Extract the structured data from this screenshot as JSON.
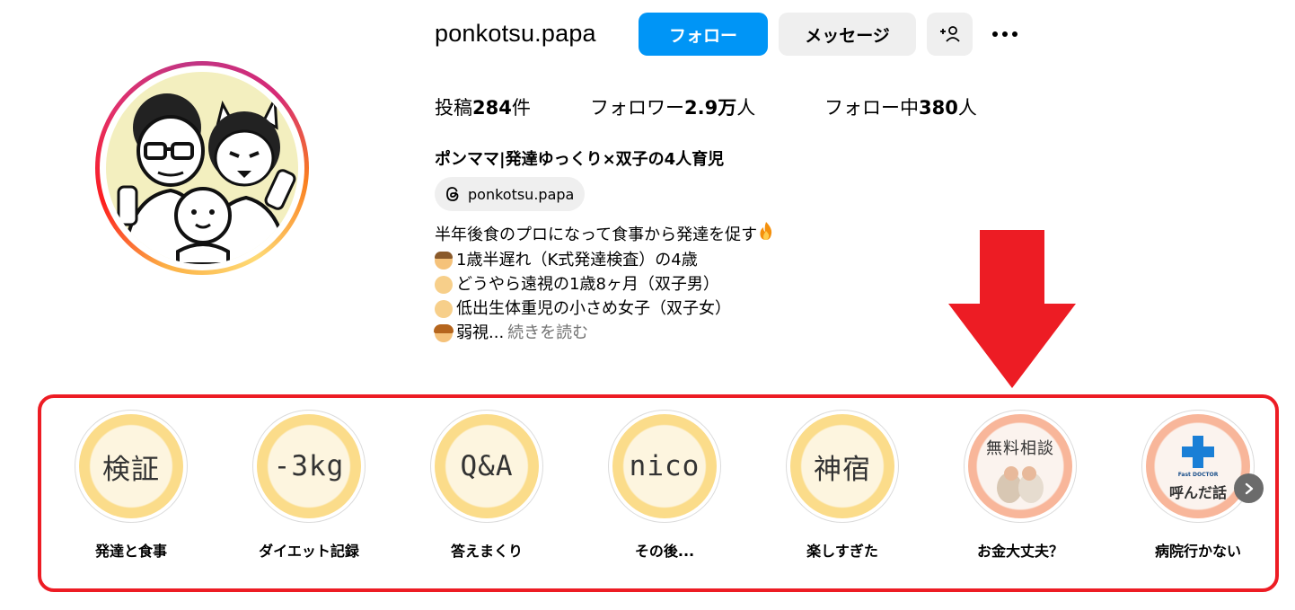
{
  "profile": {
    "username": "ponkotsu.papa",
    "follow_label": "フォロー",
    "message_label": "メッセージ",
    "add_friend_icon": "person-plus-icon",
    "more_icon": "more-options-icon",
    "stats": {
      "posts_prefix": "投稿",
      "posts_value": "284",
      "posts_suffix": "件",
      "followers_prefix": "フォロワー",
      "followers_value": "2.9万",
      "followers_suffix": "人",
      "following_prefix": "フォロー中",
      "following_value": "380",
      "following_suffix": "人"
    },
    "full_name": "ポンママ|発達ゆっくり×双子の4人育児",
    "threads_handle": "ponkotsu.papa",
    "bio_lines": [
      "半年後食のプロになって食事から発達を促す",
      "1歳半遅れ（K式発達検査）の4歳",
      "どうやら遠視の1歳8ヶ月（双子男）",
      "低出生体重児の小さめ女子（双子女）",
      "弱視..."
    ],
    "read_more": "続きを読む"
  },
  "highlights": [
    {
      "cover_text": "検証",
      "label": "発達と食事"
    },
    {
      "cover_text": "-3kg",
      "label": "ダイエット記録"
    },
    {
      "cover_text": "Q&A",
      "label": "答えまくり"
    },
    {
      "cover_text": "nico",
      "label": "その後..."
    },
    {
      "cover_text": "神宿",
      "label": "楽しすぎた"
    },
    {
      "cover_text": "無料相談",
      "label": "お金大丈夫？"
    },
    {
      "cover_text": "呼んだ話",
      "cover_logo": "Fast DOCTOR",
      "label": "病院行かない"
    }
  ],
  "colors": {
    "follow_blue": "#0095f6",
    "annotation_red": "#ed1c24",
    "secondary_button": "#efefef"
  }
}
